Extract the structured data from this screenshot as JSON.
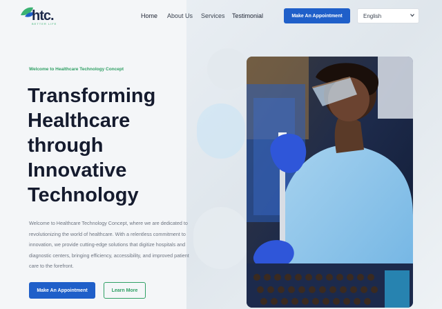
{
  "brand": {
    "name": "htc.",
    "sub": "BETTER LIFE"
  },
  "nav": {
    "items": [
      "Home",
      "About Us",
      "Services",
      "Testimonial"
    ],
    "appointment_label": "Make An Appointment",
    "language": "English"
  },
  "hero": {
    "tagline": "Welcome to Healthcare Technology Concept",
    "headline": [
      "Transforming",
      "Healthcare",
      "through",
      "Innovative",
      "Technology"
    ],
    "paragraph": "Welcome to Healthcare Technology Concept, where we are dedicated to revolutionizing the world of healthcare. With a relentless commitment to innovation, we provide cutting-edge solutions that digitize hospitals and diagnostic centers, bringing efficiency, accessibility, and improved patient care to the forefront.",
    "primary_button": "Make An Appointment",
    "secondary_button": "Learn More"
  },
  "colors": {
    "primary": "#1f5fc9",
    "accent_green": "#2e9f63",
    "heading": "#151b2e"
  }
}
